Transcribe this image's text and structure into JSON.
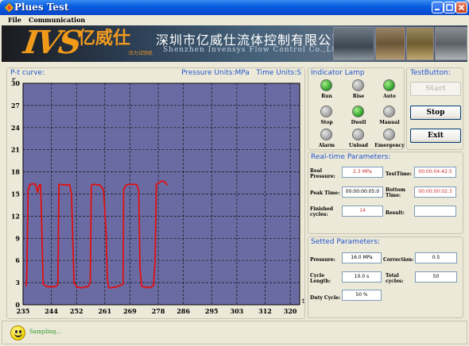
{
  "window": {
    "title": "Plues Test"
  },
  "menu": {
    "items": [
      "File",
      "Communication"
    ]
  },
  "banner": {
    "logo_en": "IVS",
    "logo_cn": "亿威仕",
    "logo_sub": "压力试验机",
    "company_cn": "深圳市亿威仕流体控制有限公司",
    "company_en": "Shenzhen Invensys Flow Control Co.,Ltd"
  },
  "chart_panel": {
    "title": "P-t curve:",
    "units": "Pressure Units:MPa   Time Units:S"
  },
  "chart_data": {
    "type": "line",
    "title": "P-t curve:",
    "ylabel": "P",
    "xlabel": "t",
    "xlim": [
      235,
      323
    ],
    "ylim": [
      0,
      30
    ],
    "x_ticks": [
      "235",
      "244",
      "252",
      "261",
      "269",
      "278",
      "286",
      "295",
      "303",
      "312",
      "320"
    ],
    "y_ticks": [
      "0",
      "3",
      "6",
      "9",
      "12",
      "15",
      "18",
      "21",
      "24",
      "27",
      "30"
    ],
    "grid": true,
    "background": "#6b6ba3",
    "series": [
      {
        "color": "#e01010",
        "x": [
          236.0,
          236.2,
          236.6,
          237.2,
          238.3,
          239.0,
          239.6,
          240.1,
          240.6,
          241.1,
          241.4,
          242.4,
          244.2,
          245.5,
          246.1,
          246.4,
          247.2,
          248.3,
          249.8,
          250.4,
          250.8,
          251.2,
          252.1,
          253.6,
          254.9,
          255.8,
          256.4,
          256.7,
          257.0,
          258.0,
          259.5,
          260.6,
          261.4,
          261.8,
          262.2,
          263.0,
          264.5,
          265.8,
          266.8,
          267.0,
          267.4,
          268.3,
          269.7,
          271.1,
          271.8,
          272.2,
          272.7,
          273.8,
          275.3,
          276.5,
          277.0,
          277.4,
          278.1,
          279.3,
          280.2,
          280.9
        ],
        "y": [
          2.5,
          4.0,
          15.5,
          16.3,
          16.4,
          16.3,
          15.2,
          16.2,
          16.3,
          8.0,
          2.8,
          2.5,
          2.4,
          2.5,
          2.8,
          16.3,
          16.3,
          16.2,
          16.3,
          15.0,
          9.0,
          3.0,
          2.4,
          2.3,
          2.4,
          2.5,
          3.0,
          16.0,
          16.3,
          16.3,
          16.2,
          15.6,
          10.0,
          3.5,
          2.3,
          2.3,
          2.4,
          2.6,
          2.8,
          15.5,
          16.0,
          16.3,
          16.3,
          16.3,
          15.5,
          5.0,
          2.5,
          2.4,
          2.3,
          2.6,
          6.0,
          16.3,
          16.5,
          16.8,
          16.6,
          16.2
        ]
      }
    ]
  },
  "indicator_panel": {
    "title": "Indicator Lamp",
    "lamps": [
      {
        "label": "Run",
        "state": "on"
      },
      {
        "label": "Rise",
        "state": "off"
      },
      {
        "label": "Auto",
        "state": "on"
      },
      {
        "label": "Stop",
        "state": "off"
      },
      {
        "label": "Dwell",
        "state": "on"
      },
      {
        "label": "Manual",
        "state": "off"
      },
      {
        "label": "Alarm",
        "state": "off"
      },
      {
        "label": "Unload",
        "state": "off"
      },
      {
        "label": "Emergency",
        "state": "off"
      }
    ]
  },
  "test_buttons": {
    "title": "TestButton:",
    "start": "Start",
    "stop": "Stop",
    "exit": "Exit"
  },
  "realtime": {
    "title": "Real-time Parameters:",
    "real_pressure_label": "Real Pressure:",
    "real_pressure_value": "2.3 MPa",
    "test_time_label": "TestTime:",
    "test_time_value": "00:00:04:42:5",
    "peak_time_label": "Peak Time:",
    "peak_time_value": "00:00:00:05:0",
    "bottom_time_label": "Bottom Time:",
    "bottom_time_value": "00:00:00:02:3",
    "finished_cycles_label": "Finished cycles:",
    "finished_cycles_value": "14",
    "result_label": "Result:",
    "result_value": ""
  },
  "setted": {
    "title": "Setted Parameters:",
    "pressure_label": "Pressure:",
    "pressure_value": "16.0 MPa",
    "correction_label": "Correction:",
    "correction_value": "0.5",
    "cycle_length_label": "Cycle Length:",
    "cycle_length_value": "10.0 s",
    "total_cycles_label": "Total cycles:",
    "total_cycles_value": "50",
    "duty_cycle_label": "Duty Cycle:",
    "duty_cycle_value": "50 %"
  },
  "status": {
    "text": "Sampling..."
  }
}
